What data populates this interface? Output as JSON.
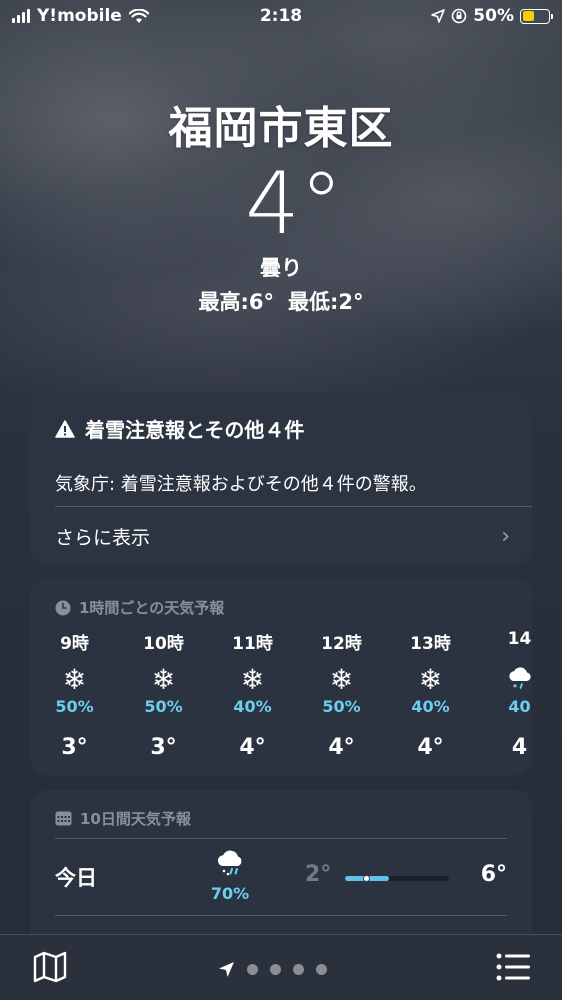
{
  "status_bar": {
    "carrier": "Y!mobile",
    "time": "2:18",
    "battery": "50%"
  },
  "current": {
    "location": "福岡市東区",
    "temperature": "4°",
    "condition": "曇り",
    "high": "最高:6°",
    "low": "最低:2°"
  },
  "alert": {
    "title": "着雪注意報とその他４件",
    "body": "気象庁: 着雪注意報およびその他４件の警報。",
    "more_label": "さらに表示"
  },
  "hourly": {
    "title": "1時間ごとの天気予報",
    "items": [
      {
        "hour": "9時",
        "icon": "snowflake-icon",
        "precip": "50%",
        "temp": "3°"
      },
      {
        "hour": "10時",
        "icon": "snowflake-icon",
        "precip": "50%",
        "temp": "3°"
      },
      {
        "hour": "11時",
        "icon": "snowflake-icon",
        "precip": "40%",
        "temp": "4°"
      },
      {
        "hour": "12時",
        "icon": "snowflake-icon",
        "precip": "50%",
        "temp": "4°"
      },
      {
        "hour": "13時",
        "icon": "snowflake-icon",
        "precip": "40%",
        "temp": "4°"
      },
      {
        "hour": "14",
        "icon": "cloud-sleet-icon",
        "precip": "40",
        "temp": "4"
      }
    ]
  },
  "ten_day": {
    "title": "10日間天気予報",
    "days": [
      {
        "day": "今日",
        "icon": "cloud-sleet-icon",
        "precip": "70%",
        "low": "2°",
        "high": "6°",
        "current_fraction": 0.2
      }
    ]
  },
  "colors": {
    "precip": "#6ccdf0",
    "range_bar": "#5ec3ec",
    "battery": "#f5d000"
  }
}
